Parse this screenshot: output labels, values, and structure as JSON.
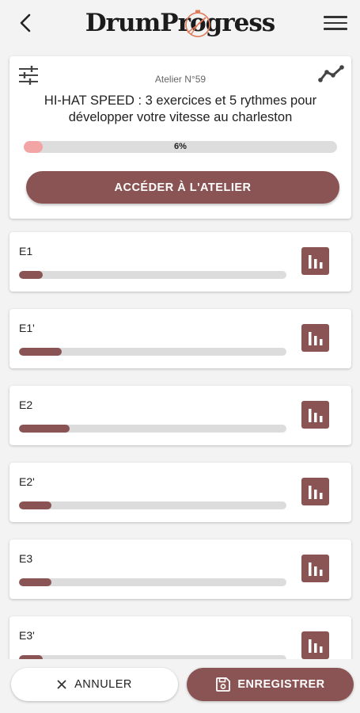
{
  "header": {
    "logo_part1": "DrumPr",
    "logo_o": "o",
    "logo_part2": "gress"
  },
  "atelier": {
    "number_label": "Atelier N°59",
    "title": "HI-HAT SPEED : 3 exercices et 5 rythmes pour développer votre vitesse au charleston",
    "progress_fraction": 0.06,
    "progress_label": "6%",
    "access_button_label": "ACCÉDER À L'ATELIER"
  },
  "exercises": [
    {
      "label": "E1",
      "progress_fraction": 0.09
    },
    {
      "label": "E1'",
      "progress_fraction": 0.16
    },
    {
      "label": "E2",
      "progress_fraction": 0.19
    },
    {
      "label": "E2'",
      "progress_fraction": 0.12
    },
    {
      "label": "E3",
      "progress_fraction": 0.12
    },
    {
      "label": "E3'",
      "progress_fraction": 0.09
    }
  ],
  "footer": {
    "cancel_label": "ANNULER",
    "save_label": "ENREGISTRER"
  },
  "colors": {
    "accent": "#8b5454",
    "progress_pink": "#f3a5a5",
    "track": "#dcdcdc",
    "background": "#f3f3f3",
    "logo_mark": "#e07b5a"
  },
  "icons": {
    "back": "back-arrow-icon",
    "menu": "hamburger-menu-icon",
    "filter": "sliders-icon",
    "chart": "line-chart-icon",
    "stats": "bar-chart-icon",
    "cancel": "close-icon",
    "save": "save-disk-icon"
  }
}
